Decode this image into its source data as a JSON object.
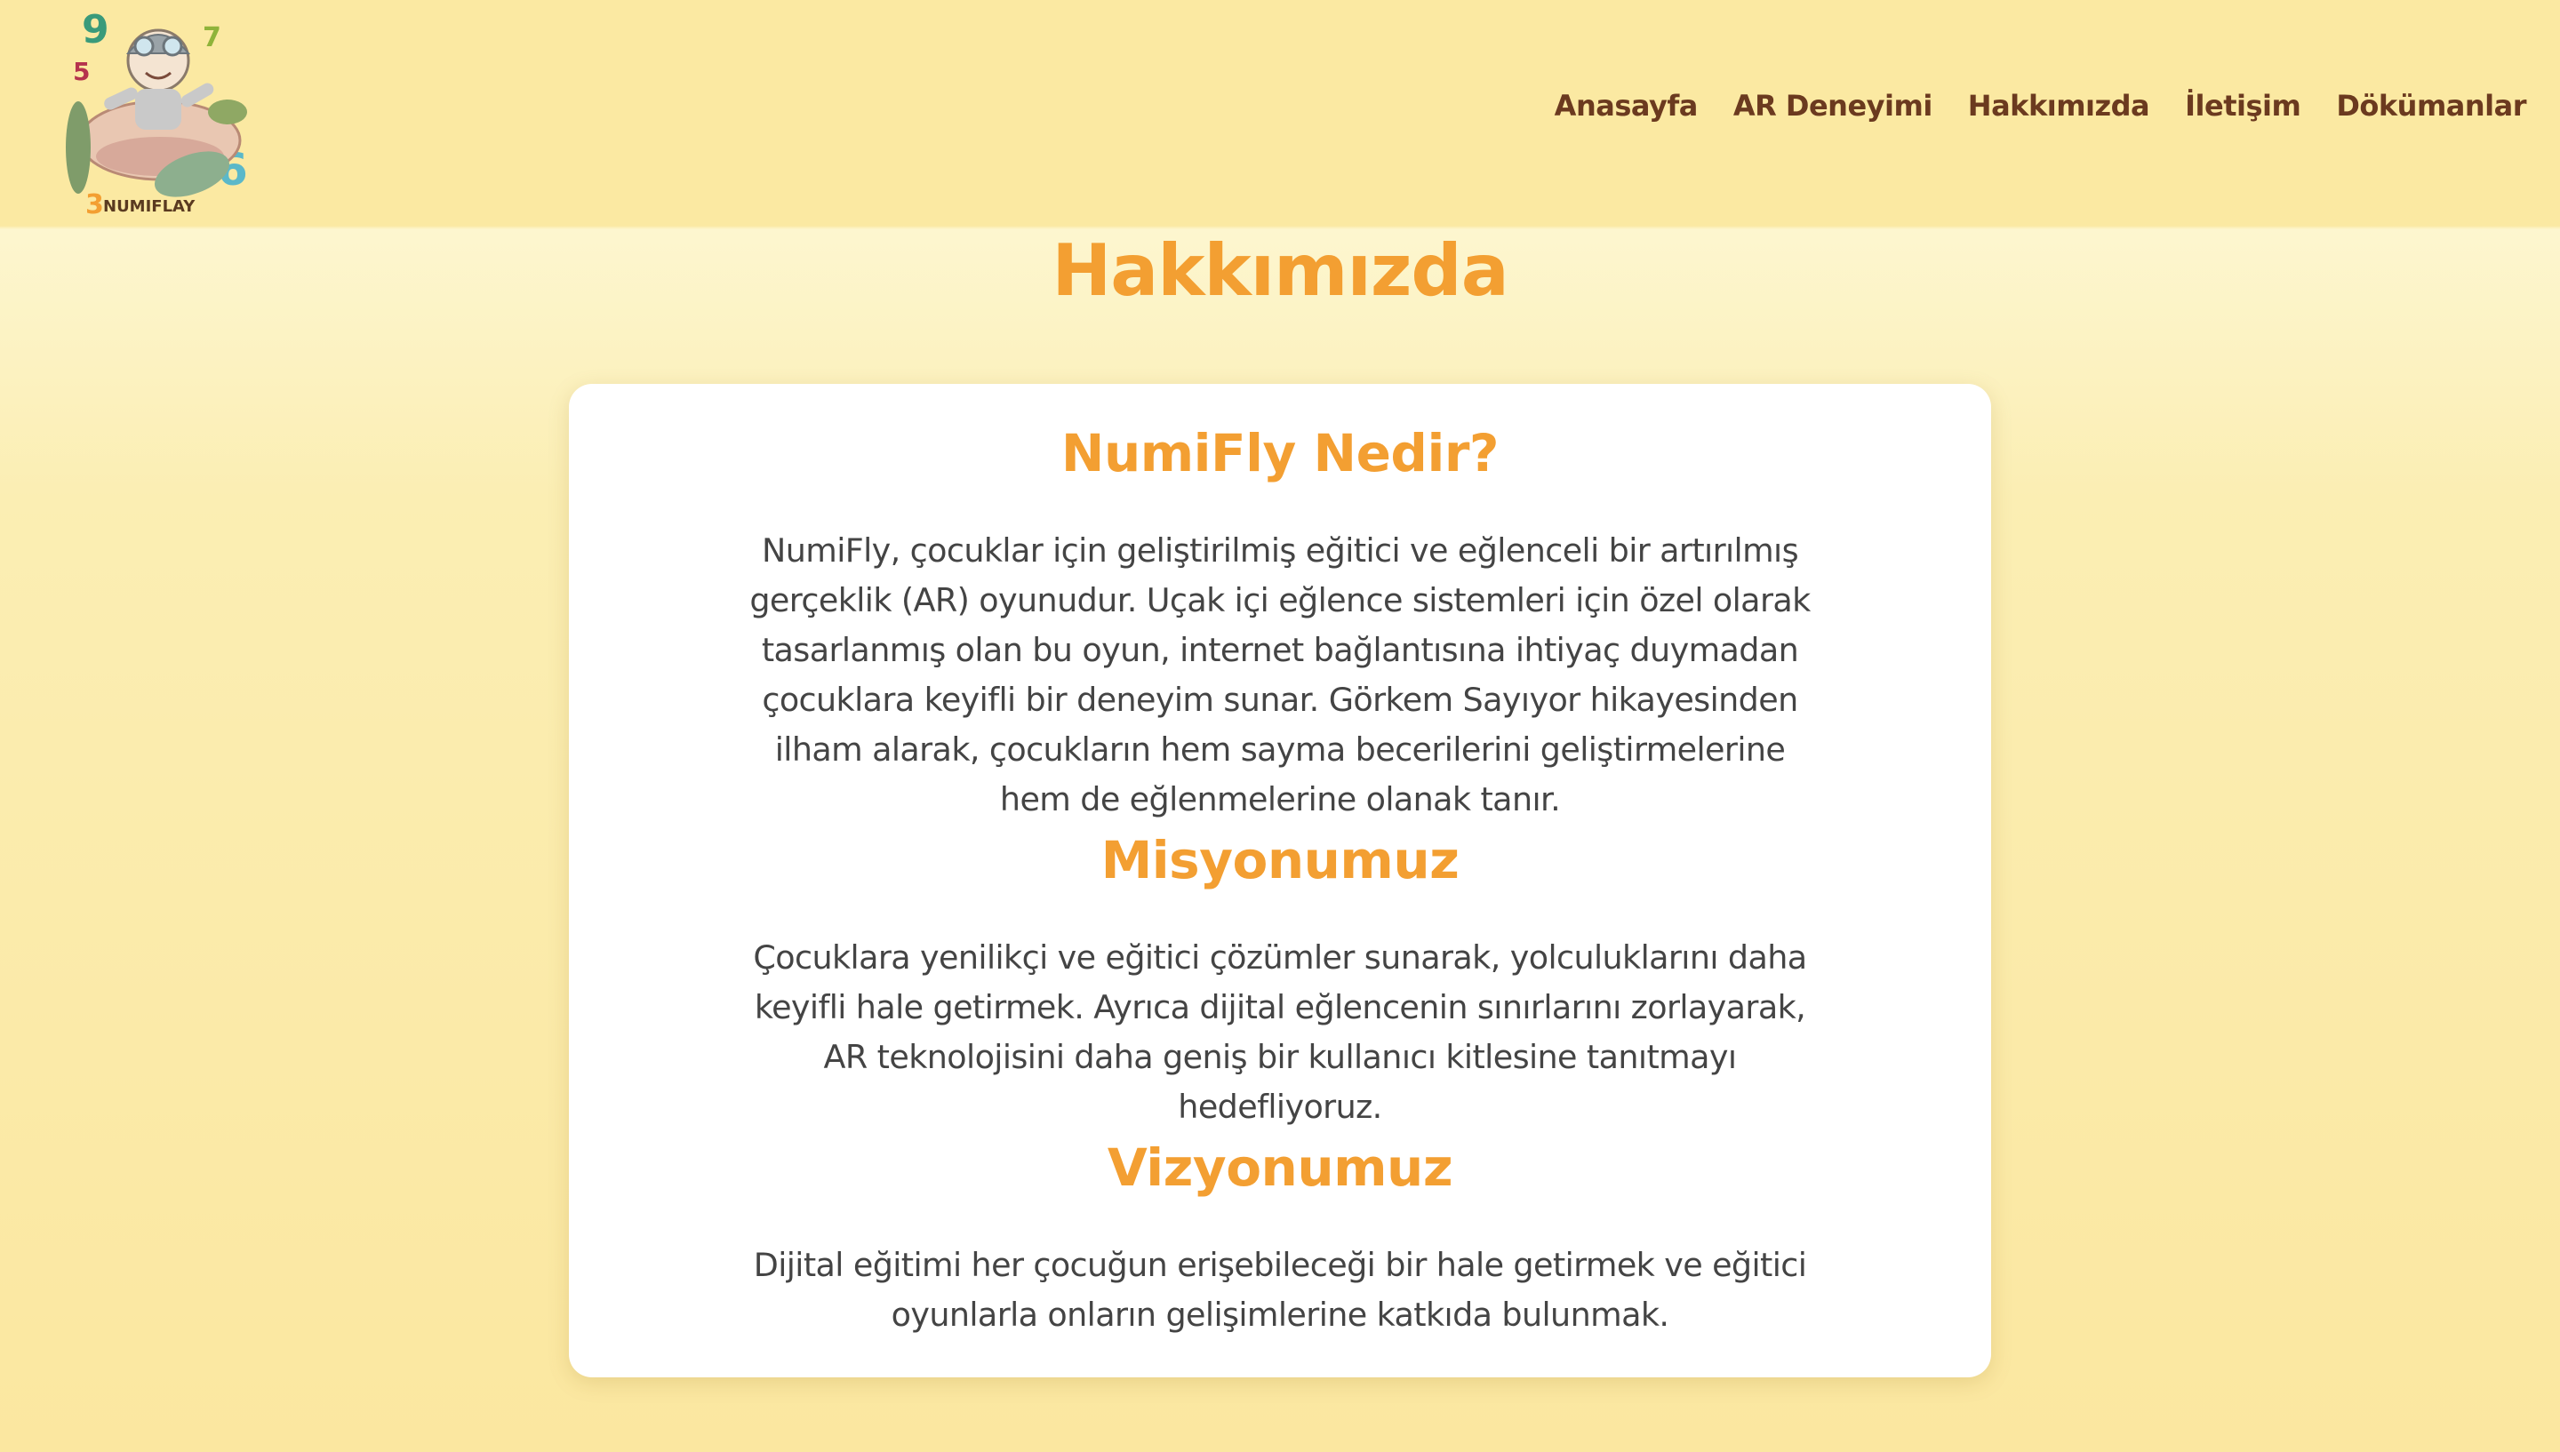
{
  "header": {
    "logo_text": "NUMIFLAY",
    "nav": [
      "Anasayfa",
      "AR Deneyimi",
      "Hakkımızda",
      "İletişim",
      "Dökümanlar"
    ]
  },
  "page_title": "Hakkımızda",
  "sections": [
    {
      "title": "NumiFly Nedir?",
      "text": "NumiFly, çocuklar için geliştirilmiş eğitici ve eğlenceli bir artırılmış gerçeklik (AR) oyunudur. Uçak içi eğlence sistemleri için özel olarak tasarlanmış olan bu oyun, internet bağlantısına ihtiyaç duymadan çocuklara keyifli bir deneyim sunar. Görkem Sayıyor hikayesinden ilham alarak, çocukların hem sayma becerilerini geliştirmelerine hem de eğlenmelerine olanak tanır."
    },
    {
      "title": "Misyonumuz",
      "text": "Çocuklara yenilikçi ve eğitici çözümler sunarak, yolculuklarını daha keyifli hale getirmek. Ayrıca dijital eğlencenin sınırlarını zorlayarak, AR teknolojisini daha geniş bir kullanıcı kitlesine tanıtmayı hedefliyoruz."
    },
    {
      "title": "Vizyonumuz",
      "text": "Dijital eğitimi her çocuğun erişebileceği bir hale getirmek ve eğitici oyunlarla onların gelişimlerine katkıda bulunmak."
    }
  ],
  "colors": {
    "background": "#fbe9a2",
    "accent": "#f39f32",
    "nav_text": "#6b3a1f",
    "body_text": "#444444",
    "card": "#ffffff"
  }
}
